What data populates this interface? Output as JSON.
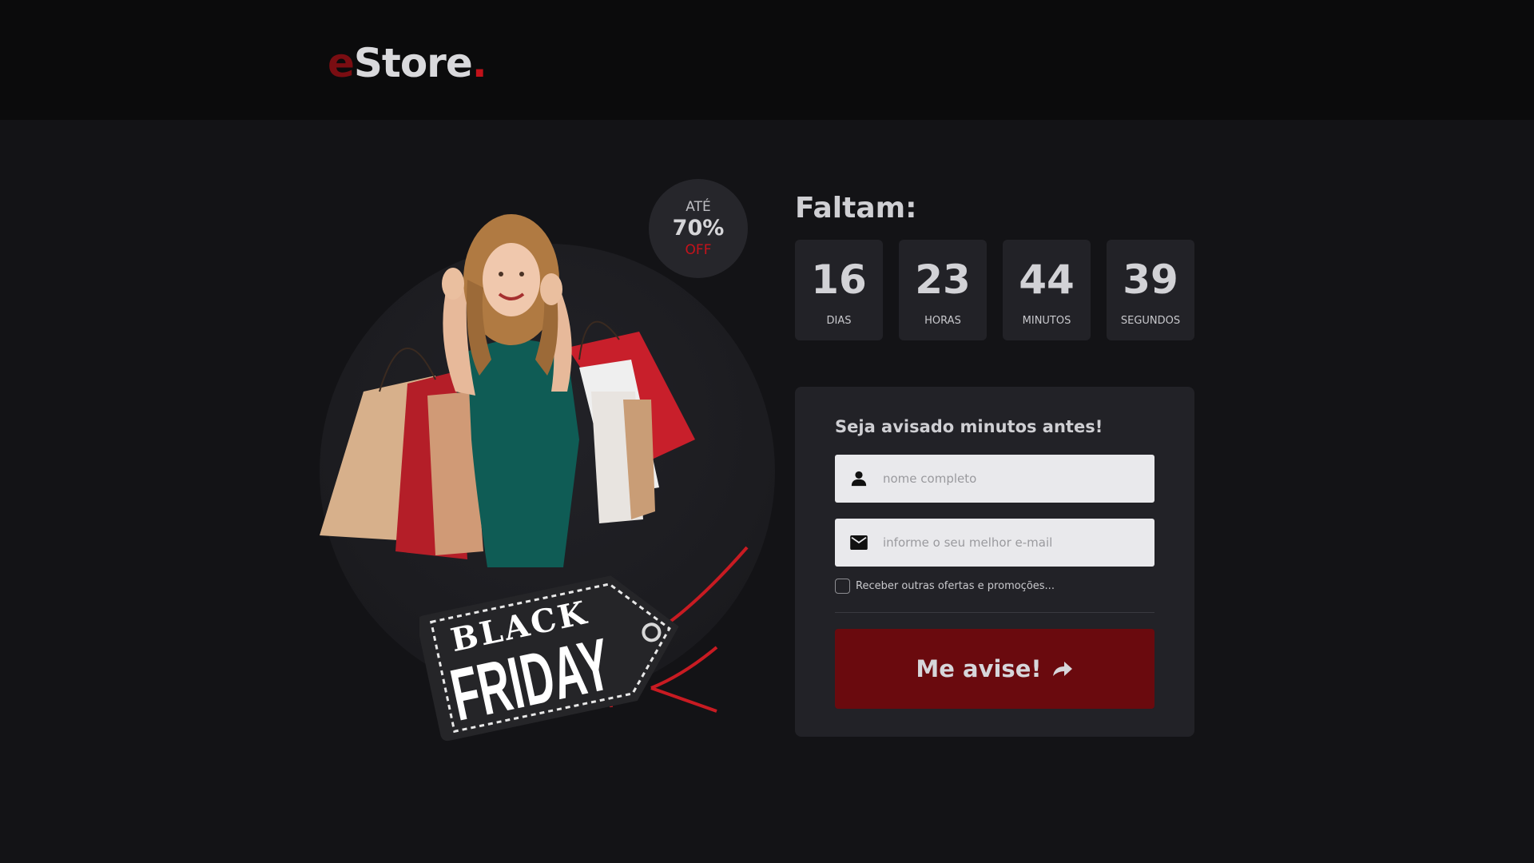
{
  "brand": {
    "logo_e": "e",
    "logo_rest": "Store",
    "logo_dot": "."
  },
  "promo_badge": {
    "line1": "ATÉ",
    "line2": "70%",
    "line3": "OFF"
  },
  "hero_tag": {
    "line1": "BLACK",
    "line2": "FRIDAY"
  },
  "countdown": {
    "title": "Faltam:",
    "items": [
      {
        "value": "16",
        "label": "DIAS"
      },
      {
        "value": "23",
        "label": "HORAS"
      },
      {
        "value": "44",
        "label": "MINUTOS"
      },
      {
        "value": "39",
        "label": "SEGUNDOS"
      }
    ]
  },
  "form": {
    "title": "Seja avisado minutos antes!",
    "name_field": {
      "placeholder": "nome completo",
      "value": "",
      "icon": "person-icon"
    },
    "email_field": {
      "placeholder": "informe o seu melhor e-mail",
      "value": "",
      "icon": "mail-icon"
    },
    "opt_in_label": "Receber outras ofertas e promoções...",
    "opt_in_checked": false,
    "submit_label": "Me avise!",
    "submit_icon": "share-arrow-icon"
  },
  "colors": {
    "background": "#131316",
    "header": "#0b0b0c",
    "card": "#222227",
    "accent_red": "#c1121a",
    "button_red": "#6a0a0e"
  }
}
